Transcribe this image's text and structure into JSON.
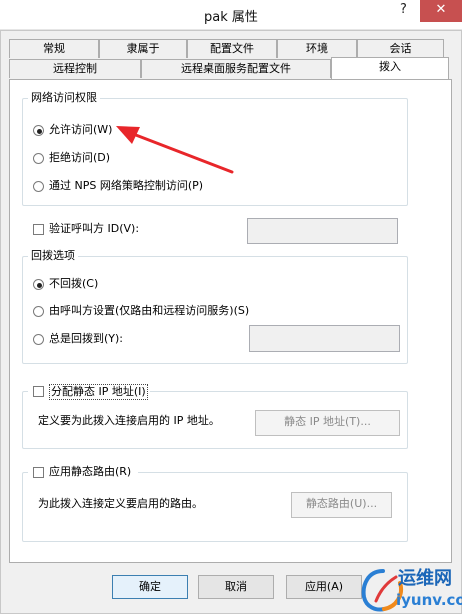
{
  "window": {
    "title": "pak 属性",
    "help": "?",
    "close": "✕"
  },
  "tabs_row1": [
    "常规",
    "隶属于",
    "配置文件",
    "环境",
    "会话"
  ],
  "tabs_row2": [
    "远程控制",
    "远程桌面服务配置文件",
    "拨入"
  ],
  "network_access": {
    "legend": "网络访问权限",
    "allow": "允许访问(W)",
    "deny": "拒绝访问(D)",
    "nps": "通过 NPS 网络策略控制访问(P)",
    "selected": "allow"
  },
  "verify_caller": {
    "label": "验证呼叫方 ID(V):",
    "checked": false,
    "value": ""
  },
  "callback": {
    "legend": "回拨选项",
    "no_callback": "不回拨(C)",
    "set_by_caller": "由呼叫方设置(仅路由和远程访问服务)(S)",
    "always": "总是回拨到(Y):",
    "selected": "no_callback",
    "value": ""
  },
  "static_ip": {
    "check_label": "分配静态 IP 地址(I)",
    "checked": false,
    "description": "定义要为此拨入连接启用的 IP 地址。",
    "button": "静态 IP 地址(T)..."
  },
  "static_routes": {
    "check_label": "应用静态路由(R)",
    "checked": false,
    "description": "为此拨入连接定义要启用的路由。",
    "button": "静态路由(U)..."
  },
  "footer": {
    "ok": "确定",
    "cancel": "取消",
    "apply": "应用(A)"
  },
  "watermark": {
    "brand": "运维网",
    "url": "iyunv.com"
  },
  "colors": {
    "annotation_arrow": "#e8262a",
    "close_button": "#c75050"
  }
}
